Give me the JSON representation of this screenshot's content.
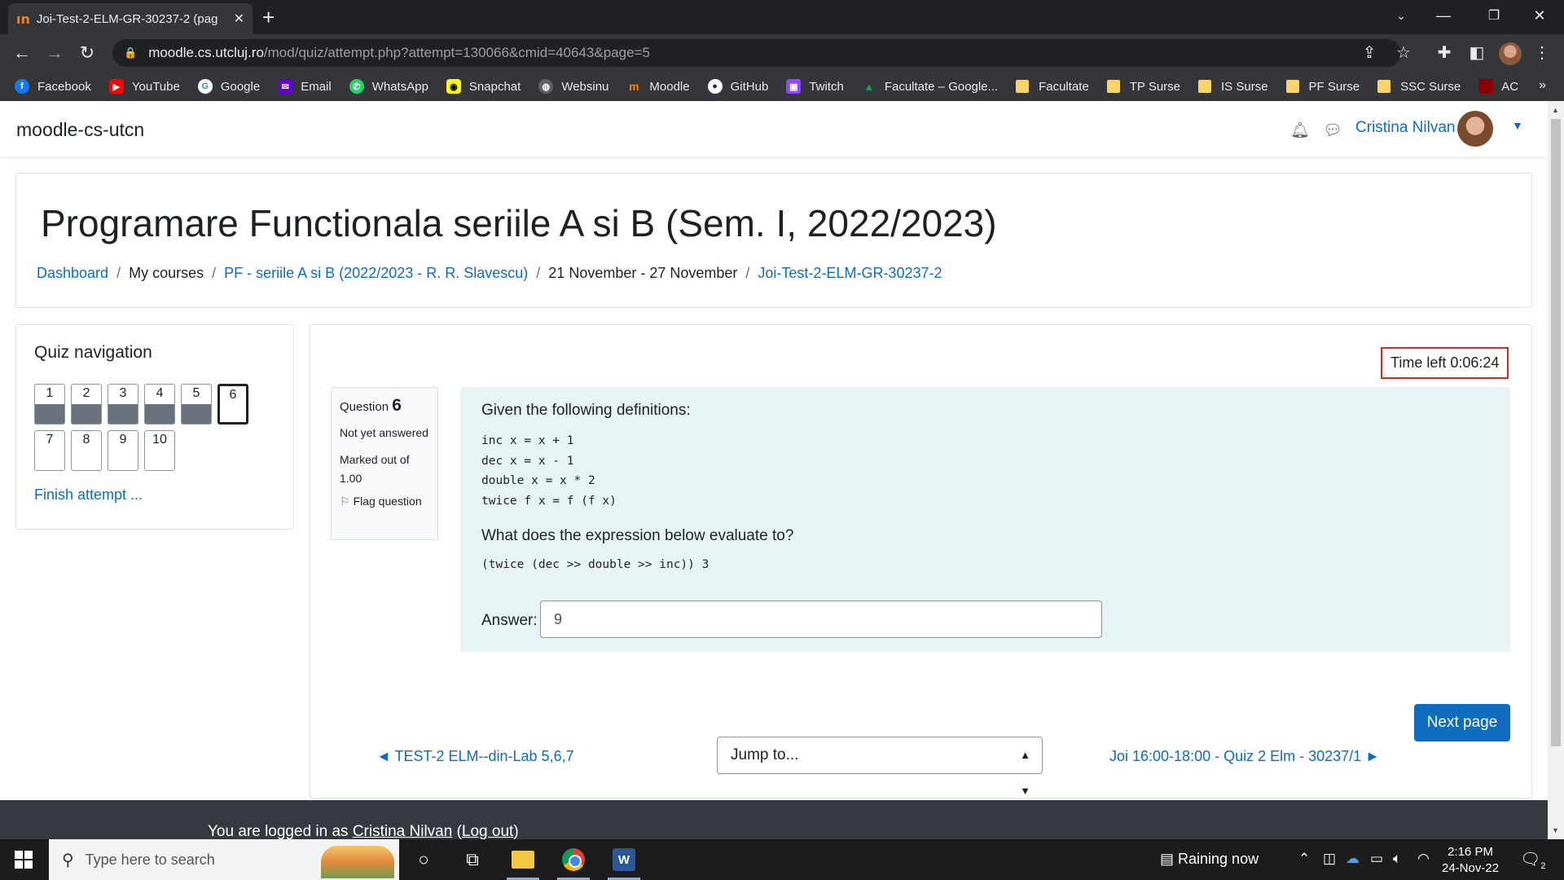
{
  "browser": {
    "tab_title": "Joi-Test-2-ELM-GR-30237-2 (pag",
    "tab_favicon": "ın",
    "new_tab": "+",
    "url_host": "moodle.cs.utcluj.ro",
    "url_path": "/mod/quiz/attempt.php?attempt=130066&cmid=40643&page=5",
    "bookmarks": [
      {
        "label": "Facebook",
        "icon": "facebook-icon",
        "color": "#1877f2",
        "glyph": "f"
      },
      {
        "label": "YouTube",
        "icon": "youtube-icon",
        "color": "#ff0000",
        "glyph": "▶"
      },
      {
        "label": "Google",
        "icon": "google-icon",
        "color": "#4285f4",
        "glyph": "G"
      },
      {
        "label": "Email",
        "icon": "email-icon",
        "color": "#6001d2",
        "glyph": "✉"
      },
      {
        "label": "WhatsApp",
        "icon": "whatsapp-icon",
        "color": "#25d366",
        "glyph": "✆"
      },
      {
        "label": "Snapchat",
        "icon": "snapchat-icon",
        "color": "#fffc00",
        "glyph": "◉"
      },
      {
        "label": "Websinu",
        "icon": "globe-icon",
        "color": "#5f6368",
        "glyph": "◍"
      },
      {
        "label": "Moodle",
        "icon": "moodle-icon",
        "color": "#f98012",
        "glyph": "m"
      },
      {
        "label": "GitHub",
        "icon": "github-icon",
        "color": "#ffffff",
        "glyph": "●"
      },
      {
        "label": "Twitch",
        "icon": "twitch-icon",
        "color": "#9146ff",
        "glyph": "▣"
      },
      {
        "label": "Facultate – Google...",
        "icon": "google-drive-icon",
        "color": "#0f9d58",
        "glyph": "▲"
      }
    ],
    "folders": [
      "Facultate",
      "TP Surse",
      "IS Surse",
      "PF Surse",
      "SSC Surse"
    ],
    "last_bookmark": "AC",
    "more": "»"
  },
  "moodle": {
    "brand": "moodle-cs-utcn",
    "user_name": "Cristina Nilvan",
    "course_title": "Programare Functionala seriile A si B (Sem. I, 2022/2023)",
    "breadcrumb": {
      "dashboard": "Dashboard",
      "my_courses": "My courses",
      "course": "PF - seriile A si B (2022/2023 - R. R. Slavescu)",
      "week": "21 November - 27 November",
      "quiz": "Joi-Test-2-ELM-GR-30237-2",
      "separator": "/"
    },
    "quiz_nav": {
      "title": "Quiz navigation",
      "questions": [
        {
          "n": "1",
          "answered": true
        },
        {
          "n": "2",
          "answered": true
        },
        {
          "n": "3",
          "answered": true
        },
        {
          "n": "4",
          "answered": true
        },
        {
          "n": "5",
          "answered": true
        },
        {
          "n": "6",
          "current": true
        },
        {
          "n": "7"
        },
        {
          "n": "8"
        },
        {
          "n": "9"
        },
        {
          "n": "10"
        }
      ],
      "finish": "Finish attempt ..."
    },
    "timer": "Time left 0:06:24",
    "question_info": {
      "label": "Question",
      "number": "6",
      "state": "Not yet answered",
      "grade": "Marked out of 1.00",
      "flag": "Flag question"
    },
    "question": {
      "intro": "Given the following definitions:",
      "definitions": [
        "inc x = x + 1",
        "dec x = x - 1",
        "double x = x * 2",
        "twice f x = f (f x)"
      ],
      "prompt": "What does the expression below evaluate to?",
      "expression": "(twice (dec >> double >> inc)) 3",
      "answer_label": "Answer:",
      "answer_value": "9"
    },
    "next_page": "Next page",
    "prev_activity": "◄ TEST-2 ELM--din-Lab 5,6,7",
    "jump_to": "Jump to...",
    "next_activity": "Joi 16:00-18:00 - Quiz 2 Elm - 30237/1 ►",
    "footer": {
      "prefix": "You are logged in as ",
      "user": "Cristina Nilvan",
      "open": " (",
      "logout": "Log out",
      "close": ")"
    }
  },
  "taskbar": {
    "search_placeholder": "Type here to search",
    "weather": "Raining now",
    "time": "2:16 PM",
    "date": "24-Nov-22",
    "notifications": "2"
  }
}
